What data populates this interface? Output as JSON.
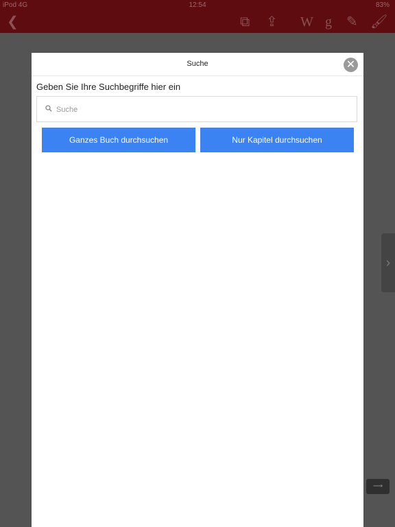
{
  "statusbar": {
    "carrier": "iPod 4G",
    "time": "12:54",
    "battery": "83%"
  },
  "toolbar": {
    "back_icon": "chevron-left-icon",
    "icons": [
      "copy-icon",
      "share-icon",
      "wikipedia-icon",
      "google-icon",
      "pencil-icon",
      "brush-icon"
    ]
  },
  "modal": {
    "title": "Suche",
    "prompt": "Geben Sie Ihre Suchbegriffe hier ein",
    "search": {
      "placeholder": "Suche",
      "value": ""
    },
    "buttons": {
      "whole_book": "Ganzes Buch durchsuchen",
      "chapter_only": "Nur Kapitel durchsuchen"
    },
    "accent_color": "#3b82f2"
  }
}
